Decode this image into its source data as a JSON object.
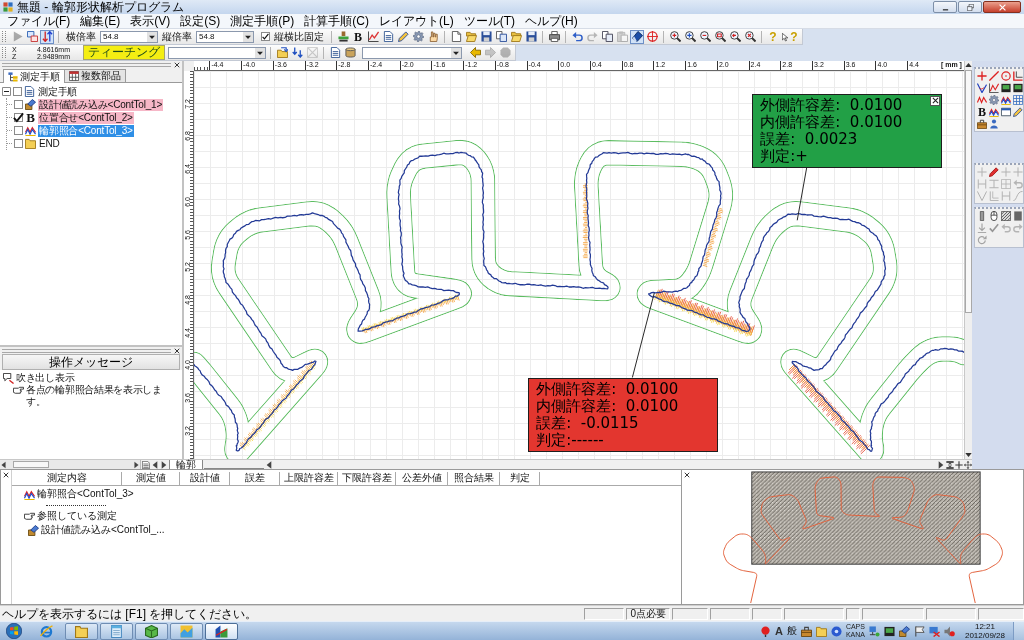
{
  "window": {
    "title": "無題 - 輪郭形状解析プログラム"
  },
  "menu": [
    "ファイル(F)",
    "編集(E)",
    "表示(V)",
    "設定(S)",
    "測定手順(P)",
    "計算手順(C)",
    "レイアウト(L)",
    "ツール(T)",
    "ヘルプ(H)"
  ],
  "toolbar": {
    "view_buttons": [
      {
        "disabled": true,
        "pressed": false
      },
      {
        "disabled": false,
        "pressed": false
      },
      {
        "disabled": false,
        "pressed": true
      }
    ],
    "scales": [
      {
        "label": "横倍率",
        "value": "54.8"
      },
      {
        "label": "縦倍率",
        "value": "54.8"
      }
    ],
    "aspect_lock": {
      "label": "縦横比固定",
      "checked": true
    },
    "alignment_button": {
      "glyph": "B"
    },
    "edit_buttons": [
      {
        "disabled": false,
        "pressed": false
      },
      {
        "disabled": true,
        "pressed": false
      },
      {
        "disabled": false,
        "pressed": false
      },
      {
        "disabled": true,
        "pressed": false
      },
      {
        "disabled": false,
        "pressed": true
      },
      {
        "disabled": false,
        "pressed": false
      }
    ],
    "help_buttons": [
      {
        "glyph": "?"
      },
      {
        "glyph": "?"
      }
    ]
  },
  "position_bar": {
    "coordinates": [
      {
        "axis": "X",
        "value": "4.8616mm"
      },
      {
        "axis": "Z",
        "value": "2.9489mm"
      }
    ],
    "teach_button": "ティーチング",
    "step_buttons": [
      {
        "disabled": false
      },
      {
        "disabled": false
      },
      {
        "disabled": true
      }
    ],
    "nav_buttons": [
      {
        "disabled": false
      },
      {
        "disabled": true
      },
      {
        "disabled": true
      }
    ]
  },
  "procedure_panel": {
    "tabs": [
      {
        "label": "測定手順",
        "selected": true
      },
      {
        "label": "複数部品",
        "selected": false
      }
    ],
    "tree": [
      {
        "label": "測定手順",
        "checked": false,
        "expanded": true,
        "selected": false,
        "highlighted": false,
        "children": [
          {
            "label": "設計値読み込み<ContTol_1>",
            "checked": false,
            "selected": false,
            "highlighted": true
          },
          {
            "label": "位置合せ<ContTol_2>",
            "glyph": "B",
            "checked": true,
            "selected": false,
            "highlighted": true
          },
          {
            "label": "輪郭照合<ContTol_3>",
            "checked": false,
            "selected": true,
            "highlighted": false
          },
          {
            "label": "END",
            "checked": false,
            "selected": false,
            "highlighted": false
          }
        ]
      }
    ]
  },
  "message_panel": {
    "title": "操作メッセージ",
    "items": [
      {
        "label": "吹き出し表示",
        "children": [
          {
            "label": "各点の輪郭照合結果を表示します。"
          }
        ]
      }
    ]
  },
  "ruler_top": {
    "labels": [
      "-4.4",
      "-4.0",
      "-3.6",
      "-3.2",
      "-2.8",
      "-2.4",
      "-2.0",
      "-1.6",
      "-1.2",
      "-0.8",
      "-0.4",
      "0.0",
      "0.4",
      "0.8",
      "1.2",
      "1.6",
      "2.0",
      "2.4",
      "2.8",
      "3.2",
      "3.6",
      "4.0",
      "4.4"
    ],
    "unit": "[ mm ]"
  },
  "ruler_left": {
    "labels": [
      "7.2",
      "6.8",
      "6.4",
      "6.0",
      "5.6",
      "5.2",
      "4.8",
      "4.4",
      "4.0",
      "3.6",
      "3.2"
    ]
  },
  "callouts": [
    {
      "color": "#22a046",
      "selected": true,
      "lines": [
        "外側許容差:  0.0100",
        "内側許容差:  0.0100",
        "誤差:  0.0023",
        "判定:+"
      ]
    },
    {
      "color": "#e3362f",
      "selected": false,
      "lines": [
        "外側許容差:  0.0100",
        "内側許容差:  0.0100",
        "誤差:  -0.0115",
        "判定:------"
      ]
    }
  ],
  "sheet_tabs": [
    {
      "label": "輪郭",
      "selected": true
    }
  ],
  "tool_palettes": {
    "alignment_button": {
      "glyph": "B"
    },
    "measure_buttons": [
      {
        "disabled": true
      },
      {
        "disabled": false
      },
      {
        "disabled": true
      },
      {
        "disabled": true
      },
      {
        "disabled": true
      },
      {
        "disabled": true
      },
      {
        "disabled": true
      },
      {
        "disabled": true
      },
      {
        "disabled": true
      },
      {
        "disabled": true
      },
      {
        "disabled": true
      },
      {
        "disabled": true
      }
    ],
    "edit_buttons": [
      {
        "disabled": false
      },
      {
        "disabled": false
      },
      {
        "disabled": false
      },
      {
        "disabled": false
      },
      {
        "disabled": true
      },
      {
        "disabled": true
      },
      {
        "disabled": true
      },
      {
        "disabled": true
      },
      {
        "disabled": true
      }
    ]
  },
  "result_table": {
    "columns": [
      "測定内容",
      "測定値",
      "設計値",
      "誤差",
      "上限許容差",
      "下限許容差",
      "公差外値",
      "照合結果",
      "判定"
    ],
    "rows": [
      {
        "label": "輪郭照合<ContTol_3>"
      }
    ],
    "reference_label": "参照している測定",
    "references": [
      "設計値読み込み<ContTol_..."
    ]
  },
  "status_bar": {
    "message": "ヘルプを表示するには [F1] を押してください。",
    "points": "0点必要"
  },
  "taskbar": {
    "apps": [
      {
        "running": false,
        "selected": false
      },
      {
        "running": true,
        "selected": false
      },
      {
        "running": true,
        "selected": false
      },
      {
        "running": true,
        "selected": false
      },
      {
        "running": true,
        "selected": false
      },
      {
        "running": true,
        "selected": true
      }
    ],
    "ime": [
      "A",
      "般"
    ],
    "locks": [
      "CAPS",
      "KANA"
    ],
    "time": "12:21",
    "date": "2012/09/28"
  }
}
